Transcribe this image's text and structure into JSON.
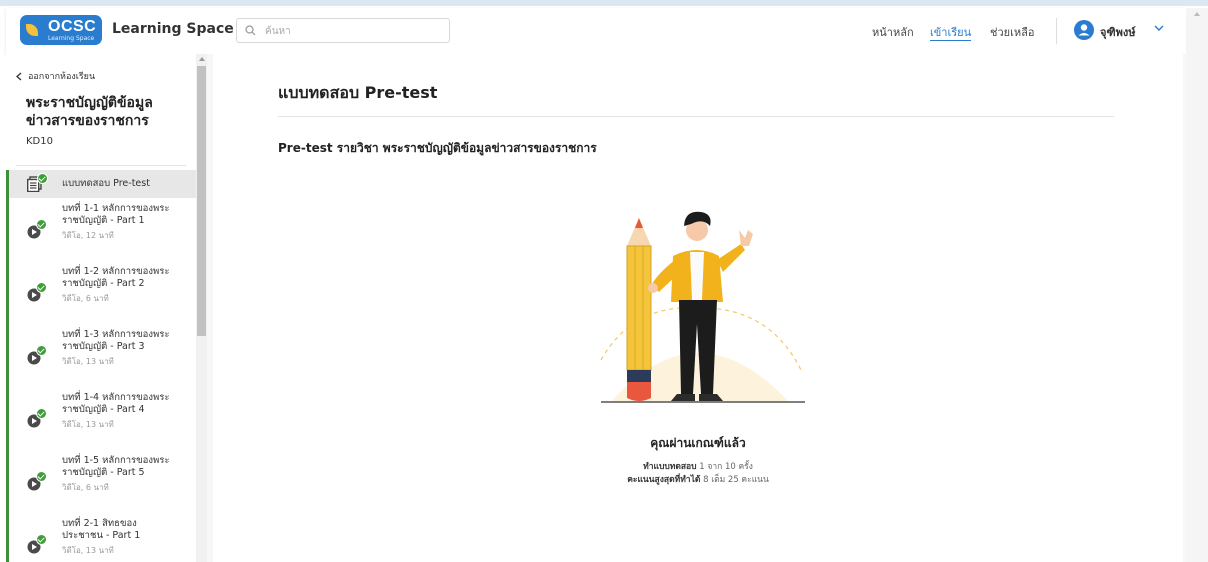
{
  "header": {
    "logo_text": "OCSC",
    "logo_sub": "Learning Space",
    "app_title": "Learning Space",
    "search_placeholder": "ค้นหา",
    "nav": [
      {
        "label": "หน้าหลัก",
        "active": false
      },
      {
        "label": "เข้าเรียน",
        "active": true
      },
      {
        "label": "ช่วยเหลือ",
        "active": false
      }
    ],
    "user_name": "จุฑิพงษ์"
  },
  "sidebar": {
    "back_label": "ออกจากห้องเรียน",
    "course_title": "พระราชบัญญัติข้อมูลข่าวสารของราชการ",
    "course_code": "KD10",
    "items": [
      {
        "title": "แบบทดสอบ Pre-test",
        "meta": "",
        "icon": "quiz-icon",
        "status": "completed"
      },
      {
        "title": "บทที่ 1-1 หลักการของพระ\nราชบัญญัติ - Part 1",
        "meta": "วิดีโอ, 12 นาที",
        "icon": "video-play-icon",
        "status": "completed"
      },
      {
        "title": "บทที่ 1-2 หลักการของพระ\nราชบัญญัติ - Part 2",
        "meta": "วิดีโอ, 6 นาที",
        "icon": "video-play-icon",
        "status": "completed"
      },
      {
        "title": "บทที่ 1-3 หลักการของพระ\nราชบัญญัติ - Part 3",
        "meta": "วิดีโอ, 13 นาที",
        "icon": "video-play-icon",
        "status": "completed"
      },
      {
        "title": "บทที่ 1-4 หลักการของพระ\nราชบัญญัติ - Part 4",
        "meta": "วิดีโอ, 13 นาที",
        "icon": "video-play-icon",
        "status": "completed"
      },
      {
        "title": "บทที่ 1-5 หลักการของพระ\nราชบัญญัติ - Part 5",
        "meta": "วิดีโอ, 6 นาที",
        "icon": "video-play-icon",
        "status": "completed"
      },
      {
        "title": "บทที่ 2-1 สิทธของ\nประชาชน - Part 1",
        "meta": "วิดีโอ, 13 นาที",
        "icon": "video-play-icon",
        "status": "completed"
      }
    ]
  },
  "main": {
    "page_title": "แบบทดสอบ Pre-test",
    "subtitle": "Pre-test รายวิชา พระราชบัญญัติข้อมูลข่าวสารของราชการ",
    "result_title": "คุณผ่านเกณฑ์แล้ว",
    "attempts_label": "ทำแบบทดสอบ",
    "attempts_text": "1 จาก 10 ครั้ง",
    "score_label": "คะแนนสูงสุดที่ทำได้",
    "score_text": "8 เต็ม 25 คะแนน"
  },
  "colors": {
    "accent": "#2a7ccf",
    "complete": "#3f9e3a",
    "progress_bar": "#3f8f3a",
    "jacket": "#f2b21c"
  }
}
